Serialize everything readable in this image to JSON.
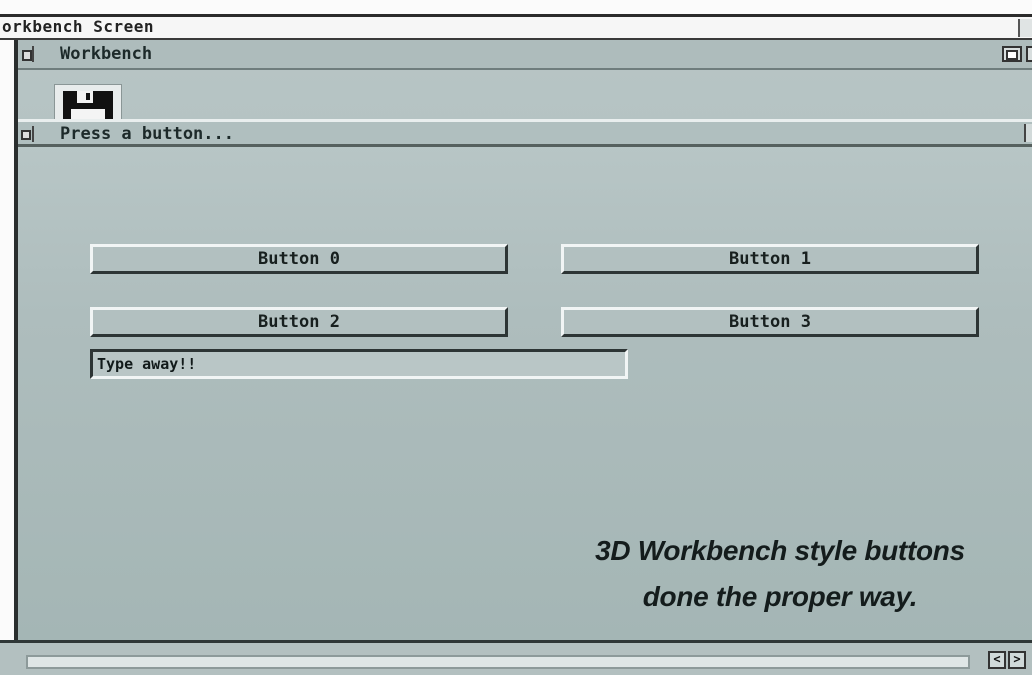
{
  "screen": {
    "title": "orkbench Screen"
  },
  "window": {
    "title": "Workbench"
  },
  "inner_window": {
    "title": "Press a button..."
  },
  "buttons": [
    {
      "label": "Button 0"
    },
    {
      "label": "Button 1"
    },
    {
      "label": "Button 2"
    },
    {
      "label": "Button 3"
    }
  ],
  "text_field": {
    "value": "Type away!!"
  },
  "caption": {
    "line1": "3D Workbench style buttons",
    "line2": "done the proper way."
  },
  "scroll": {
    "left_arrow": "<",
    "right_arrow": ">"
  }
}
